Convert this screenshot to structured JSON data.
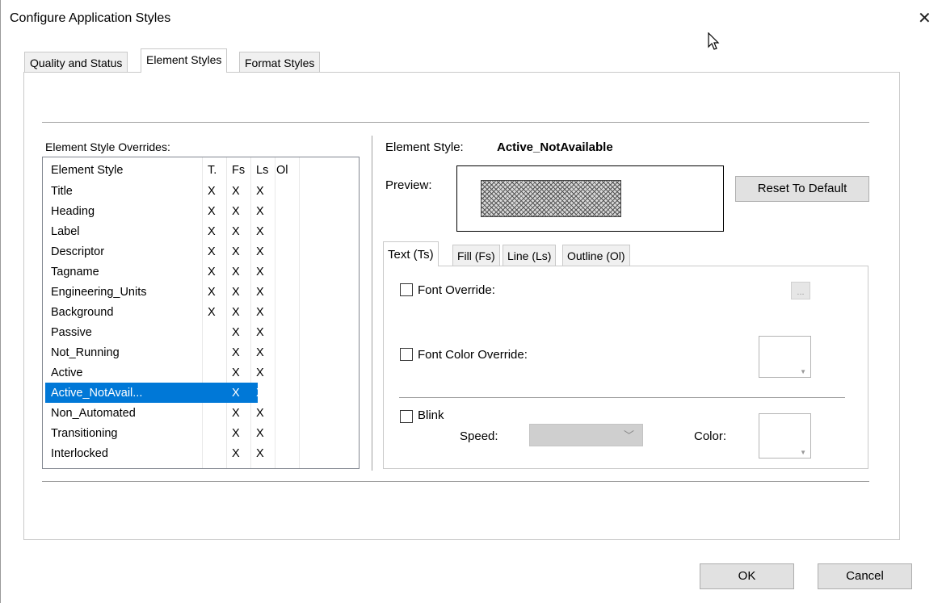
{
  "window": {
    "title": "Configure Application Styles",
    "close": "✕"
  },
  "tabs": [
    "Quality and Status",
    "Element Styles",
    "Format Styles"
  ],
  "overrides": {
    "label": "Element Style Overrides:",
    "columns": [
      "Element Style",
      "T.",
      "Fs",
      "Ls",
      "Ol"
    ],
    "rows": [
      {
        "name": "Title",
        "t": "X",
        "fs": "X",
        "ls": "X",
        "ol": ""
      },
      {
        "name": "Heading",
        "t": "X",
        "fs": "X",
        "ls": "X",
        "ol": ""
      },
      {
        "name": "Label",
        "t": "X",
        "fs": "X",
        "ls": "X",
        "ol": ""
      },
      {
        "name": "Descriptor",
        "t": "X",
        "fs": "X",
        "ls": "X",
        "ol": ""
      },
      {
        "name": "Tagname",
        "t": "X",
        "fs": "X",
        "ls": "X",
        "ol": ""
      },
      {
        "name": "Engineering_Units",
        "t": "X",
        "fs": "X",
        "ls": "X",
        "ol": ""
      },
      {
        "name": "Background",
        "t": "X",
        "fs": "X",
        "ls": "X",
        "ol": ""
      },
      {
        "name": "Passive",
        "t": "",
        "fs": "X",
        "ls": "X",
        "ol": ""
      },
      {
        "name": "Not_Running",
        "t": "",
        "fs": "X",
        "ls": "X",
        "ol": ""
      },
      {
        "name": "Active",
        "t": "",
        "fs": "X",
        "ls": "X",
        "ol": ""
      },
      {
        "name": "Active_NotAvail...",
        "t": "",
        "fs": "X",
        "ls": "X",
        "ol": "",
        "selected": true
      },
      {
        "name": "Non_Automated",
        "t": "",
        "fs": "X",
        "ls": "X",
        "ol": ""
      },
      {
        "name": "Transitioning",
        "t": "",
        "fs": "X",
        "ls": "X",
        "ol": ""
      },
      {
        "name": "Interlocked",
        "t": "",
        "fs": "X",
        "ls": "X",
        "ol": ""
      }
    ]
  },
  "detail": {
    "element_style_label": "Element Style:",
    "element_style_value": "Active_NotAvailable",
    "preview_label": "Preview:",
    "reset_button": "Reset To Default",
    "inner_tabs": [
      "Text (Ts)",
      "Fill (Fs)",
      "Line (Ls)",
      "Outline (Ol)"
    ],
    "font_override": "Font Override:",
    "font_button": "...",
    "font_color_override": "Font Color Override:",
    "blink": "Blink",
    "speed_label": "Speed:",
    "color_label": "Color:"
  },
  "footer": {
    "ok": "OK",
    "cancel": "Cancel"
  }
}
